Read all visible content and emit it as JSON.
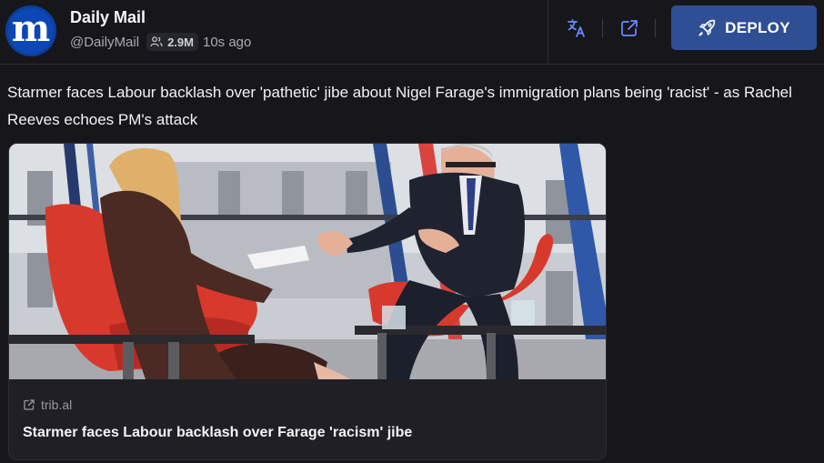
{
  "account": {
    "name": "Daily Mail",
    "handle": "@DailyMail",
    "followers": "2.9M",
    "time_ago": "10s ago",
    "avatar_icon": "daily-mail-logo",
    "avatar_letter": "m"
  },
  "toolbar": {
    "translate_icon": "translate-icon",
    "open_icon": "external-link-icon",
    "deploy_label": "DEPLOY",
    "deploy_icon": "rocket-icon"
  },
  "post": {
    "text": "Starmer faces Labour backlash over 'pathetic' jibe about Nigel Farage's immigration plans being 'racist' - as Rachel Reeves echoes PM's attack"
  },
  "link_card": {
    "image_description_icon": "news-photo",
    "domain": "trib.al",
    "title": "Starmer faces Labour backlash over Farage 'racism' jibe"
  },
  "colors": {
    "background": "#17171b",
    "deploy_button": "#2f4f94",
    "accent_icon": "#6c8dff",
    "avatar_blue": "#0d47b5"
  }
}
